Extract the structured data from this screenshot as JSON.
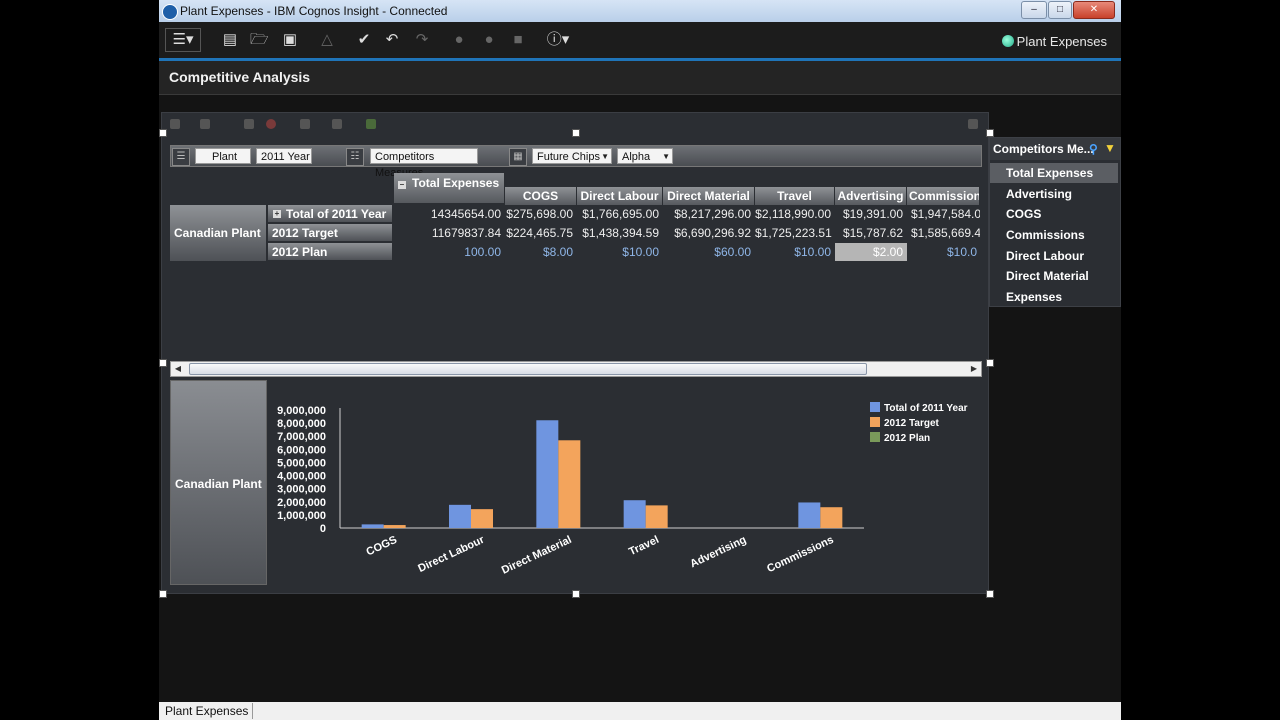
{
  "window": {
    "title": "Plant Expenses - IBM Cognos Insight - Connected"
  },
  "toolbar": {
    "app_name": "Plant Expenses"
  },
  "header": {
    "title": "Competitive Analysis"
  },
  "dimensions": [
    {
      "label": "Plant"
    },
    {
      "label": "2011 Year"
    },
    {
      "label": "Competitors Measures"
    },
    {
      "label": "Future Chips"
    },
    {
      "label": "Alpha"
    }
  ],
  "grid": {
    "top_header": "Total Expenses",
    "columns": [
      "COGS",
      "Direct Labour",
      "Direct Material",
      "Travel",
      "Advertising",
      "Commission"
    ],
    "row_dim": "Canadian Plant",
    "rows": [
      {
        "label": "Total of 2011 Year",
        "total": "14345654.00",
        "values": [
          "$275,698.00",
          "$1,766,695.00",
          "$8,217,296.00",
          "$2,118,990.00",
          "$19,391.00",
          "$1,947,584.0"
        ]
      },
      {
        "label": "2012 Target",
        "total": "11679837.84",
        "values": [
          "$224,465.75",
          "$1,438,394.59",
          "$6,690,296.92",
          "$1,725,223.51",
          "$15,787.62",
          "$1,585,669.4"
        ]
      },
      {
        "label": "2012 Plan",
        "total": "100.00",
        "values": [
          "$8.00",
          "$10.00",
          "$60.00",
          "$10.00",
          "$2.00",
          "$10.0"
        ]
      }
    ]
  },
  "chart_data": {
    "type": "bar",
    "row_label": "Canadian Plant",
    "categories": [
      "COGS",
      "Direct Labour",
      "Direct Material",
      "Travel",
      "Advertising",
      "Commissions"
    ],
    "series": [
      {
        "name": "Total of 2011 Year",
        "color": "#6f95e0",
        "values": [
          275698,
          1766695,
          8217296,
          2118990,
          19391,
          1947584
        ]
      },
      {
        "name": "2012 Target",
        "color": "#f3a45c",
        "values": [
          224465.75,
          1438394.59,
          6690296.92,
          1725223.51,
          15787.62,
          1585669.4
        ]
      },
      {
        "name": "2012 Plan",
        "color": "#7a9a5a",
        "values": [
          8,
          10,
          60,
          10,
          2,
          10
        ]
      }
    ],
    "yticks": [
      "9,000,000",
      "8,000,000",
      "7,000,000",
      "6,000,000",
      "5,000,000",
      "4,000,000",
      "3,000,000",
      "2,000,000",
      "1,000,000",
      "0"
    ],
    "ylim": [
      0,
      9000000
    ],
    "legend": "top-right"
  },
  "side_panel": {
    "title": "Competitors Me...",
    "items": [
      "Total Expenses",
      "Advertising",
      "COGS",
      "Commissions",
      "Direct Labour",
      "Direct Material",
      "Expenses"
    ]
  },
  "status": {
    "tab": "Plant Expenses"
  }
}
